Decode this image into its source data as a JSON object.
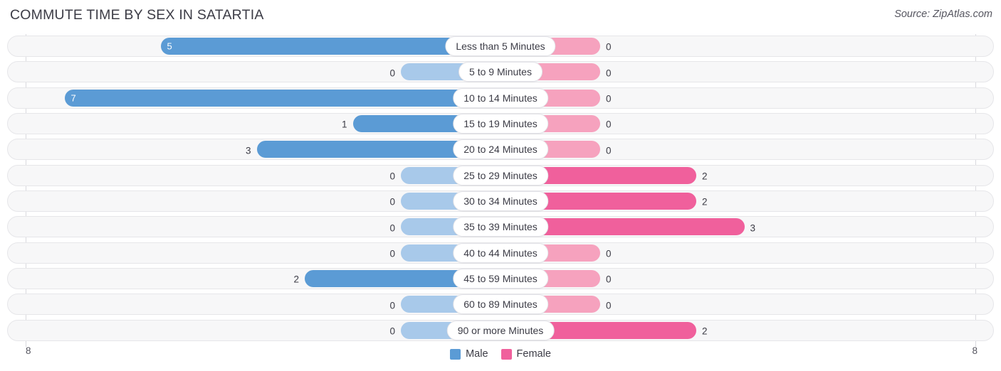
{
  "header": {
    "title": "COMMUTE TIME BY SEX IN SATARTIA",
    "source": "Source: ZipAtlas.com"
  },
  "legend": {
    "male_label": "Male",
    "female_label": "Female",
    "male_color": "#5b9bd5",
    "female_color": "#f0609c"
  },
  "colors": {
    "male_strong": "#5b9bd5",
    "male_light": "#a8c9ea",
    "female_strong": "#f0609c",
    "female_light": "#f6a2be",
    "track_fill": "#f7f7f8",
    "track_border": "#e6e6e9",
    "gridline": "#d9d9de",
    "text": "#3c3c46"
  },
  "axis": {
    "left_tick": "8",
    "right_tick": "8",
    "max": 8
  },
  "chart_data": {
    "type": "bar",
    "subtype": "diverging-bidirectional-bar",
    "title": "COMMUTE TIME BY SEX IN SATARTIA",
    "xlabel": "",
    "ylabel": "",
    "xlim": [
      8,
      8
    ],
    "grid": true,
    "legend_position": "bottom-center",
    "categories": [
      "Less than 5 Minutes",
      "5 to 9 Minutes",
      "10 to 14 Minutes",
      "15 to 19 Minutes",
      "20 to 24 Minutes",
      "25 to 29 Minutes",
      "30 to 34 Minutes",
      "35 to 39 Minutes",
      "40 to 44 Minutes",
      "45 to 59 Minutes",
      "60 to 89 Minutes",
      "90 or more Minutes"
    ],
    "series": [
      {
        "name": "Male",
        "direction": "left",
        "values": [
          5,
          0,
          7,
          1,
          3,
          0,
          0,
          0,
          0,
          2,
          0,
          0
        ]
      },
      {
        "name": "Female",
        "direction": "right",
        "values": [
          0,
          0,
          0,
          0,
          0,
          2,
          2,
          3,
          0,
          0,
          0,
          2
        ]
      }
    ]
  },
  "rows": [
    {
      "category": "Less than 5 Minutes",
      "male": 5,
      "male_text": "5",
      "female": 0,
      "female_text": "0"
    },
    {
      "category": "5 to 9 Minutes",
      "male": 0,
      "male_text": "0",
      "female": 0,
      "female_text": "0"
    },
    {
      "category": "10 to 14 Minutes",
      "male": 7,
      "male_text": "7",
      "female": 0,
      "female_text": "0"
    },
    {
      "category": "15 to 19 Minutes",
      "male": 1,
      "male_text": "1",
      "female": 0,
      "female_text": "0"
    },
    {
      "category": "20 to 24 Minutes",
      "male": 3,
      "male_text": "3",
      "female": 0,
      "female_text": "0"
    },
    {
      "category": "25 to 29 Minutes",
      "male": 0,
      "male_text": "0",
      "female": 2,
      "female_text": "2"
    },
    {
      "category": "30 to 34 Minutes",
      "male": 0,
      "male_text": "0",
      "female": 2,
      "female_text": "2"
    },
    {
      "category": "35 to 39 Minutes",
      "male": 0,
      "male_text": "0",
      "female": 3,
      "female_text": "3"
    },
    {
      "category": "40 to 44 Minutes",
      "male": 0,
      "male_text": "0",
      "female": 0,
      "female_text": "0"
    },
    {
      "category": "45 to 59 Minutes",
      "male": 2,
      "male_text": "2",
      "female": 0,
      "female_text": "0"
    },
    {
      "category": "60 to 89 Minutes",
      "male": 0,
      "male_text": "0",
      "female": 0,
      "female_text": "0"
    },
    {
      "category": "90 or more Minutes",
      "male": 0,
      "male_text": "0",
      "female": 2,
      "female_text": "2"
    }
  ]
}
